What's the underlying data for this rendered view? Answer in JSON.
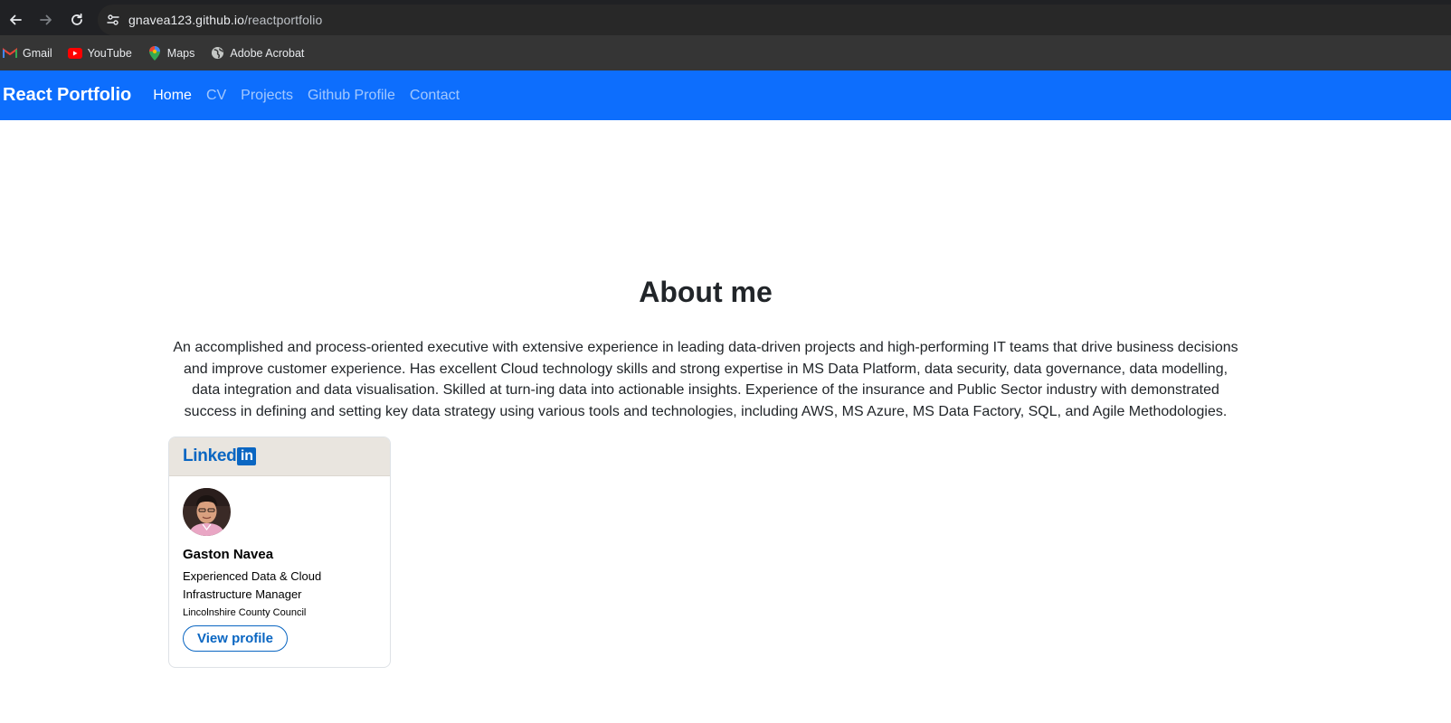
{
  "browser": {
    "url_host": "gnavea123.github.io",
    "url_path": "/reactportfolio",
    "bookmarks": [
      {
        "label": "Gmail",
        "icon": "gmail-icon"
      },
      {
        "label": "YouTube",
        "icon": "youtube-icon"
      },
      {
        "label": "Maps",
        "icon": "maps-icon"
      },
      {
        "label": "Adobe Acrobat",
        "icon": "globe-icon"
      }
    ]
  },
  "navbar": {
    "brand": "React Portfolio",
    "links": [
      "Home",
      "CV",
      "Projects",
      "Github Profile",
      "Contact"
    ],
    "active": "Home"
  },
  "about": {
    "title": "About me",
    "text": "An accomplished and process-oriented executive with extensive experience in leading data-driven projects and high-performing IT teams that drive business decisions and improve customer experience. Has excellent Cloud technology skills and strong expertise in MS Data Platform, data security, data governance, data modelling, data integration and data visualisation. Skilled at turn-ing data into actionable insights. Experience of the insurance and Public Sector industry with demonstrated success in defining and setting key data strategy using various tools and technologies, including AWS, MS Azure, MS Data Factory, SQL, and Agile Methodologies."
  },
  "linkedin_card": {
    "logo_word": "Linked",
    "logo_box": "in",
    "name": "Gaston Navea",
    "title": "Experienced Data & Cloud Infrastructure Manager",
    "org": "Lincolnshire County Council",
    "button": "View profile"
  },
  "colors": {
    "navbar": "#0d6efd",
    "linkedin": "#0a66c2"
  }
}
